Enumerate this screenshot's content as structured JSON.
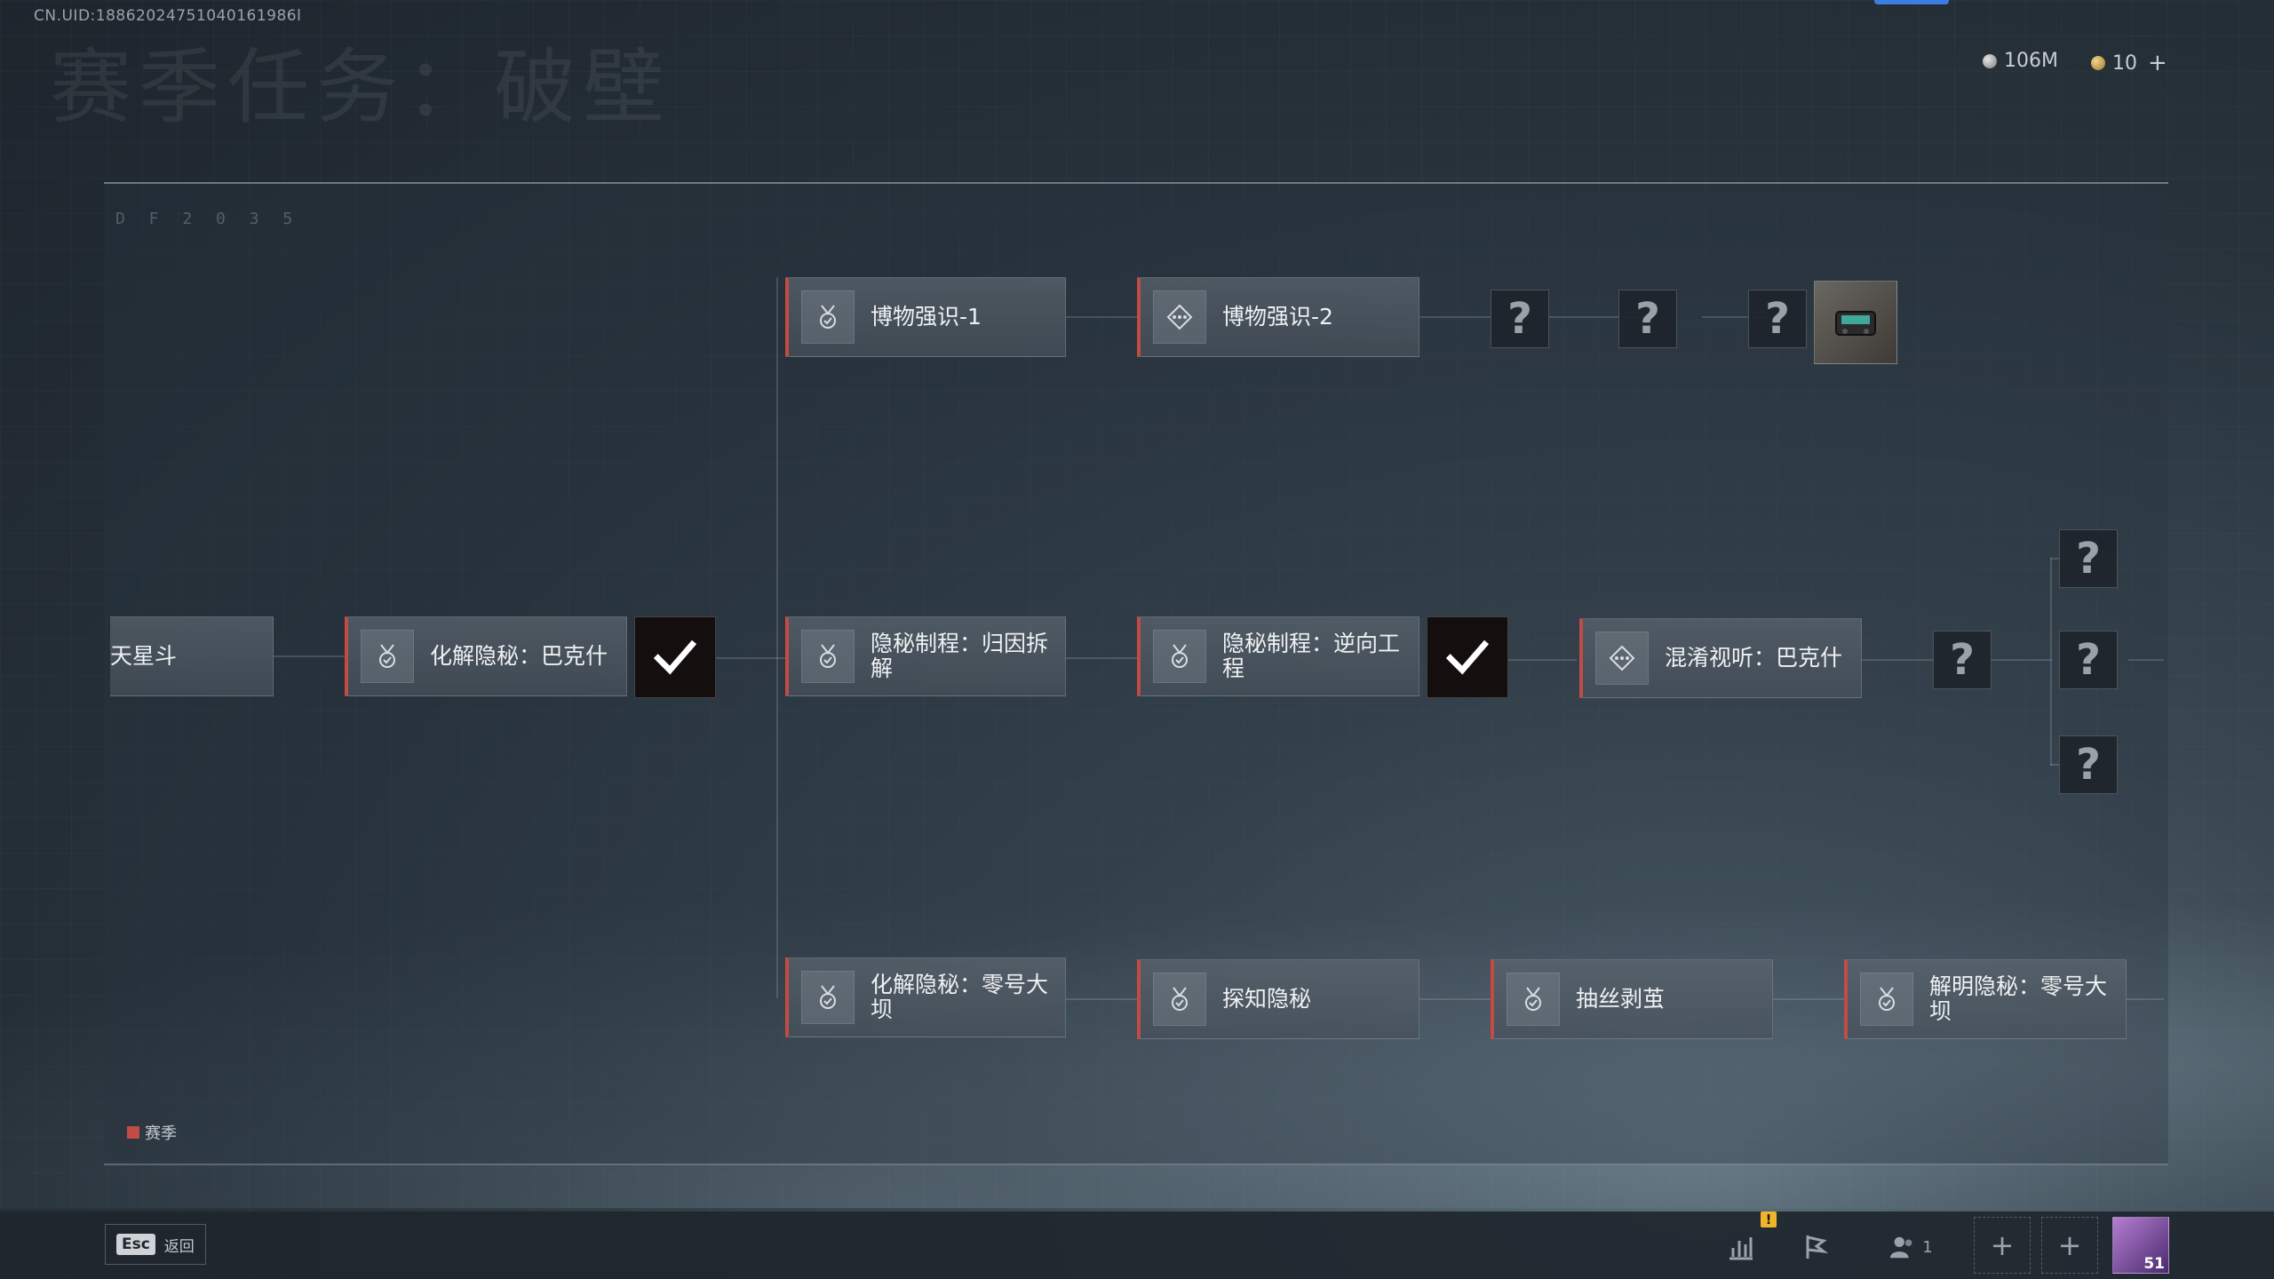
{
  "uid": "CN.UID:18862024751040161986l",
  "page_title": "赛季任务：破壁",
  "currency": {
    "silver": "106M",
    "gold": "10"
  },
  "panel_deco": "D F  2  0  3  5",
  "nodes": {
    "left_partial": "天星斗",
    "huajie_bakeshi": "化解隐秘：巴克什",
    "bowu_1": "博物强识-1",
    "bowu_2": "博物强识-2",
    "guiyin": "隐秘制程：归因拆解",
    "nixiang": "隐秘制程：逆向工程",
    "hunxiao": "混淆视听：巴克什",
    "huajie_dam": "化解隐秘：零号大坝",
    "tanzhi": "探知隐秘",
    "chousi": "抽丝剥茧",
    "jieming": "解明隐秘：零号大坝"
  },
  "unknown_mark": "?",
  "legend": {
    "label": "赛季",
    "color": "#c24b45"
  },
  "bottom": {
    "esc_key": "Esc",
    "back_label": "返回",
    "warning": "!",
    "friends_count": "1",
    "level": "51"
  },
  "icons": {
    "task": "medal-check-icon",
    "intel": "diamond-dots-icon",
    "completed": "checkmark-icon",
    "stats": "bar-chart-icon",
    "flag": "flag-icon",
    "friends": "friends-icon",
    "add": "plus-icon"
  },
  "colors": {
    "season_accent": "#c24b45",
    "top_accent": "#3b7de0"
  }
}
